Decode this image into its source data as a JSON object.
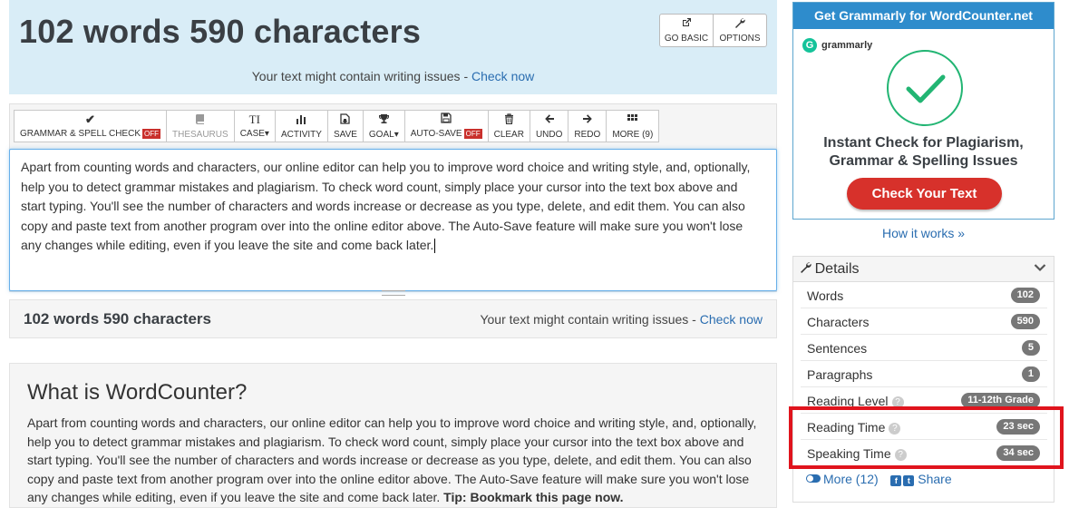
{
  "header": {
    "title": "102 words 590 characters",
    "go_basic": "GO BASIC",
    "options": "OPTIONS",
    "issues_text": "Your text might contain writing issues - ",
    "check_now": "Check now"
  },
  "toolbar": {
    "grammar": "GRAMMAR & SPELL CHECK",
    "grammar_state": "OFF",
    "thesaurus": "THESAURUS",
    "case": "CASE▾",
    "activity": "ACTIVITY",
    "save": "SAVE",
    "goal": "GOAL▾",
    "autosave": "AUTO-SAVE",
    "autosave_state": "OFF",
    "clear": "CLEAR",
    "undo": "UNDO",
    "redo": "REDO",
    "more": "MORE (9)"
  },
  "editor": {
    "text": "Apart from counting words and characters, our online editor can help you to improve word choice and writing style, and, optionally, help you to detect grammar mistakes and plagiarism. To check word count, simply place your cursor into the text box above and start typing. You'll see the number of characters and words increase or decrease as you type, delete, and edit them. You can also copy and paste text from another program over into the online editor above. The Auto-Save feature will make sure you won't lose any changes while editing, even if you leave the site and come back later."
  },
  "stats": {
    "title": "102 words 590 characters",
    "issues_text": "Your text might contain writing issues - ",
    "check_now": "Check now"
  },
  "about": {
    "heading": "What is WordCounter?",
    "body": "Apart from counting words and characters, our online editor can help you to improve word choice and writing style, and, optionally, help you to detect grammar mistakes and plagiarism. To check word count, simply place your cursor into the text box above and start typing. You'll see the number of characters and words increase or decrease as you type, delete, and edit them. You can also copy and paste text from another program over into the online editor above. The Auto-Save feature will make sure you won't lose any changes while editing, even if you leave the site and come back later. ",
    "tip": "Tip: Bookmark this page now."
  },
  "ad": {
    "header": "Get Grammarly for WordCounter.net",
    "brand": "grammarly",
    "headline_1": "Instant Check for Plagiarism,",
    "headline_2": "Grammar & Spelling Issues",
    "cta": "Check Your Text",
    "how_it_works": "How it works »"
  },
  "details": {
    "title": "Details",
    "rows": [
      {
        "label": "Words",
        "value": "102"
      },
      {
        "label": "Characters",
        "value": "590"
      },
      {
        "label": "Sentences",
        "value": "5"
      },
      {
        "label": "Paragraphs",
        "value": "1"
      },
      {
        "label": "Reading Level",
        "value": "11-12th Grade"
      },
      {
        "label": "Reading Time",
        "value": "23 sec"
      },
      {
        "label": "Speaking Time",
        "value": "34 sec"
      }
    ],
    "more": "More (12)",
    "share": "Share"
  },
  "colors": {
    "header_bg": "#d9edf7",
    "link": "#2a6db0",
    "off_badge": "#c9302c",
    "ad_header": "#2e8ccc",
    "cta": "#d7312b",
    "highlight": "#e0141d"
  }
}
